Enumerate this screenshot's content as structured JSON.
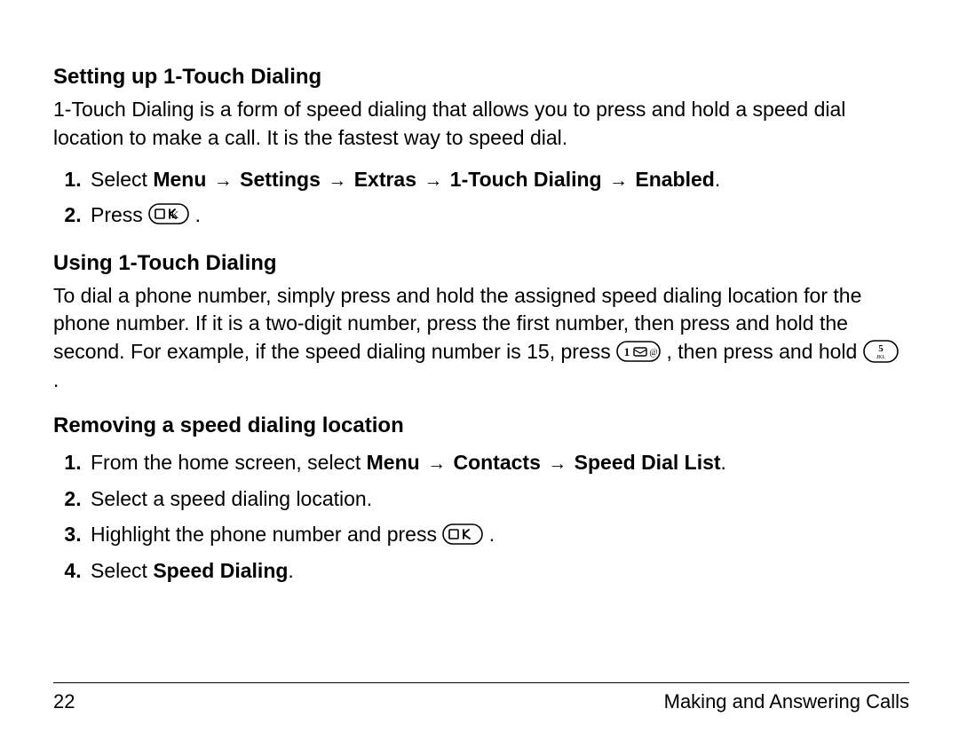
{
  "sections": [
    {
      "heading": "Setting up 1-Touch Dialing",
      "body": "1-Touch Dialing is a form of speed dialing that allows you to press and hold a speed dial location to make a call. It is the fastest way to speed dial.",
      "steps": [
        {
          "prefix": "Select ",
          "path": [
            "Menu",
            "Settings",
            "Extras",
            "1-Touch Dialing",
            "Enabled"
          ],
          "suffix": "."
        },
        {
          "text_before_icon": "Press ",
          "icon": "ok",
          "text_after_icon": " ."
        }
      ]
    },
    {
      "heading": "Using 1-Touch Dialing",
      "body_parts": {
        "p1": "To dial a phone number, simply press and hold the assigned speed dialing location for the phone number. If it is a two-digit number, press the first number, then press and hold the second. For example, if the speed dialing number is 15, press ",
        "p2": ", then press and hold ",
        "p3": "."
      }
    },
    {
      "heading": "Removing a speed dialing location",
      "steps": [
        {
          "prefix": "From the home screen, select ",
          "path": [
            "Menu",
            "Contacts",
            "Speed Dial List"
          ],
          "suffix": "."
        },
        {
          "plain": "Select a speed dialing location."
        },
        {
          "text_before_icon": "Highlight the phone number and press ",
          "icon": "ok",
          "text_after_icon": " ."
        },
        {
          "prefix": "Select ",
          "bold": "Speed Dialing",
          "suffix": "."
        }
      ]
    }
  ],
  "footer": {
    "page_number": "22",
    "chapter": "Making and Answering Calls"
  },
  "icons": {
    "ok_label": "OK",
    "key1_label": "1",
    "key5_label": "5",
    "key5_sub": "JKL"
  }
}
